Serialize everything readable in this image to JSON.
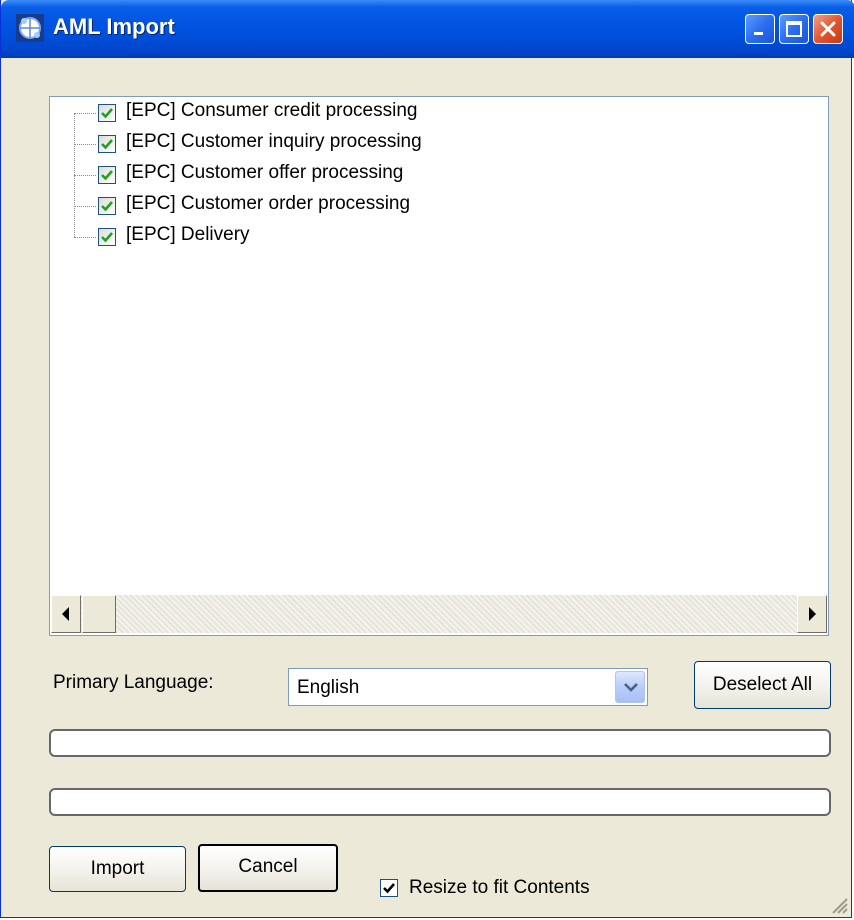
{
  "window": {
    "title": "AML Import"
  },
  "tree": {
    "items": [
      {
        "label": "[EPC] Consumer credit processing",
        "checked": true
      },
      {
        "label": "[EPC] Customer inquiry processing",
        "checked": true
      },
      {
        "label": "[EPC] Customer offer processing",
        "checked": true
      },
      {
        "label": "[EPC] Customer order processing",
        "checked": true
      },
      {
        "label": "[EPC] Delivery",
        "checked": true
      }
    ]
  },
  "language": {
    "label": "Primary Language:",
    "selected": "English"
  },
  "buttons": {
    "deselect_all": "Deselect All",
    "import": "Import",
    "cancel": "Cancel"
  },
  "progress": {
    "bar1": 0,
    "bar2": 0
  },
  "resize_option": {
    "label": "Resize to fit Contents",
    "checked": true
  },
  "colors": {
    "titlebar": "#0054E3",
    "dialog_bg": "#ECE9D8",
    "check_green": "#21A121"
  }
}
